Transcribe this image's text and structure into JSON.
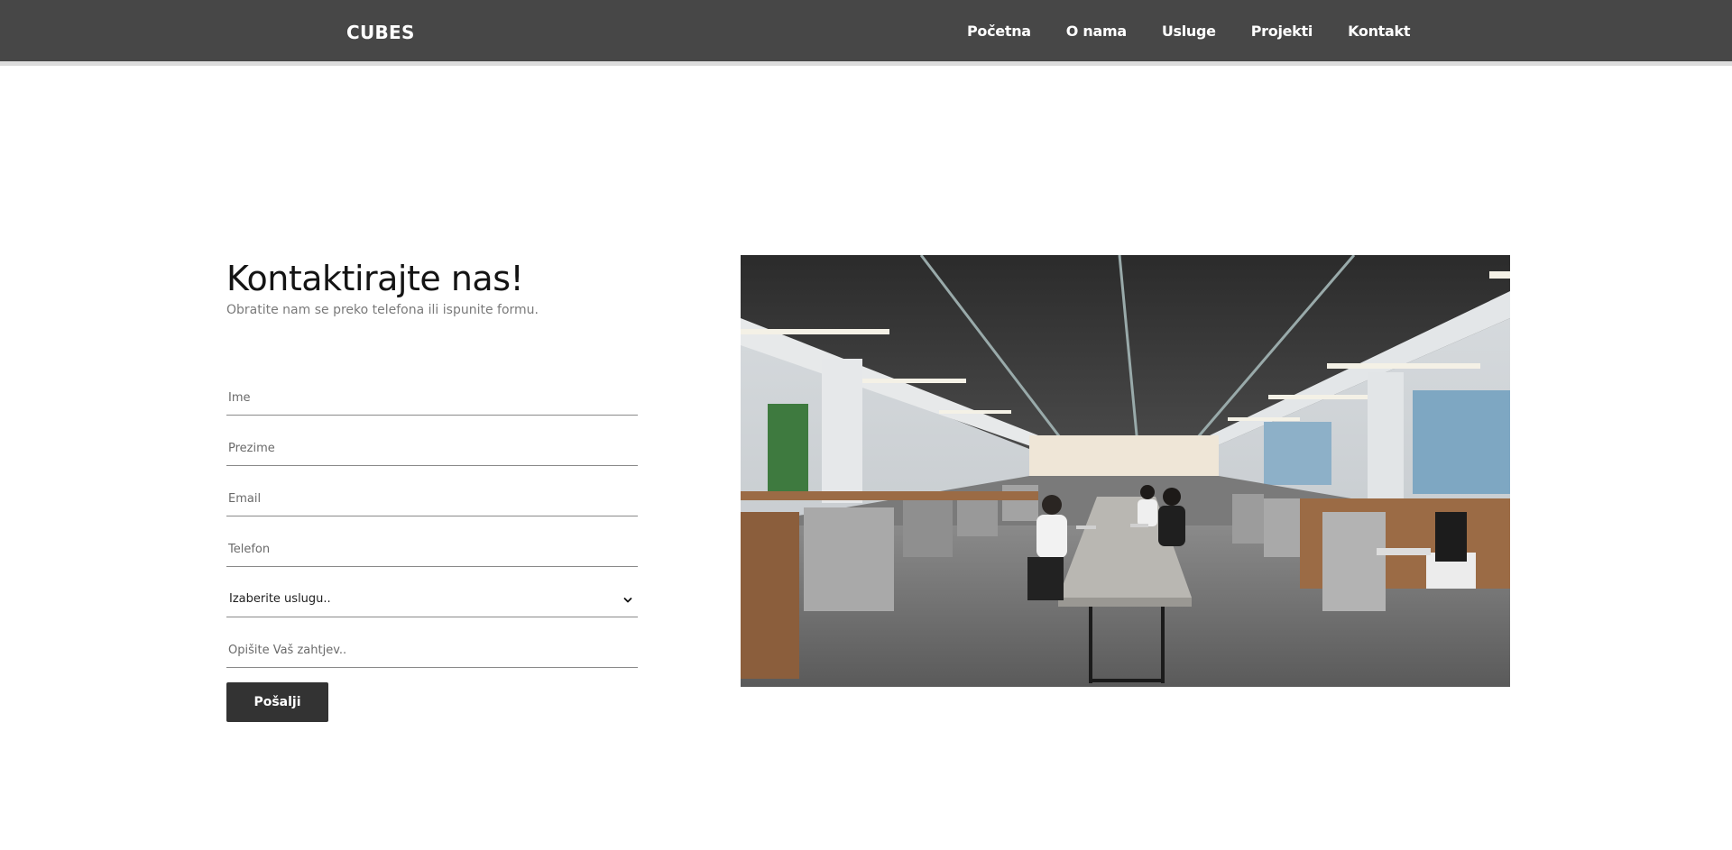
{
  "header": {
    "brand": "CUBES",
    "nav": [
      "Početna",
      "O nama",
      "Usluge",
      "Projekti",
      "Kontakt"
    ]
  },
  "contact": {
    "title": "Kontaktirajte nas!",
    "subtitle": "Obratite nam se preko telefona ili ispunite formu."
  },
  "form": {
    "first_name_placeholder": "Ime",
    "last_name_placeholder": "Prezime",
    "email_placeholder": "Email",
    "phone_placeholder": "Telefon",
    "service_selected": "Izaberite uslugu..",
    "message_placeholder": "Opišite Vaš zahtjev..",
    "submit_label": "Pošalji"
  },
  "colors": {
    "header_bg": "#474747",
    "button_bg": "#333333",
    "text": "#141414"
  },
  "icons": {
    "select_arrow": "chevron-down-icon"
  }
}
